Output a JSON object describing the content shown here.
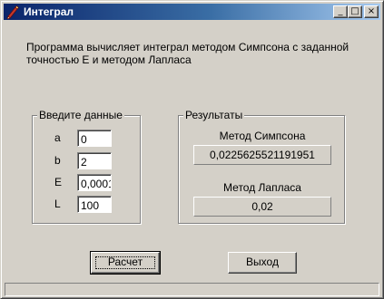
{
  "window": {
    "title": "Интеграл",
    "controls": {
      "minimize": "_",
      "maximize": "□",
      "close": "×"
    }
  },
  "description": "Программа вычисляет интеграл методом Симпсона с заданной точностью Е и  методом Лапласа",
  "input_group": {
    "label": "Введите данные",
    "fields": [
      {
        "label": "a",
        "value": "0"
      },
      {
        "label": "b",
        "value": "2"
      },
      {
        "label": "E",
        "value": "0,0001"
      },
      {
        "label": "L",
        "value": "100"
      }
    ]
  },
  "results_group": {
    "label": "Результаты",
    "simpson_label": "Метод Симпсона",
    "simpson_value": "0,0225625521191951",
    "laplace_label": "Метод Лапласа",
    "laplace_value": "0,02"
  },
  "buttons": {
    "calculate": "Расчет",
    "exit": "Выход"
  },
  "icons": {
    "app": "pencil-icon"
  }
}
